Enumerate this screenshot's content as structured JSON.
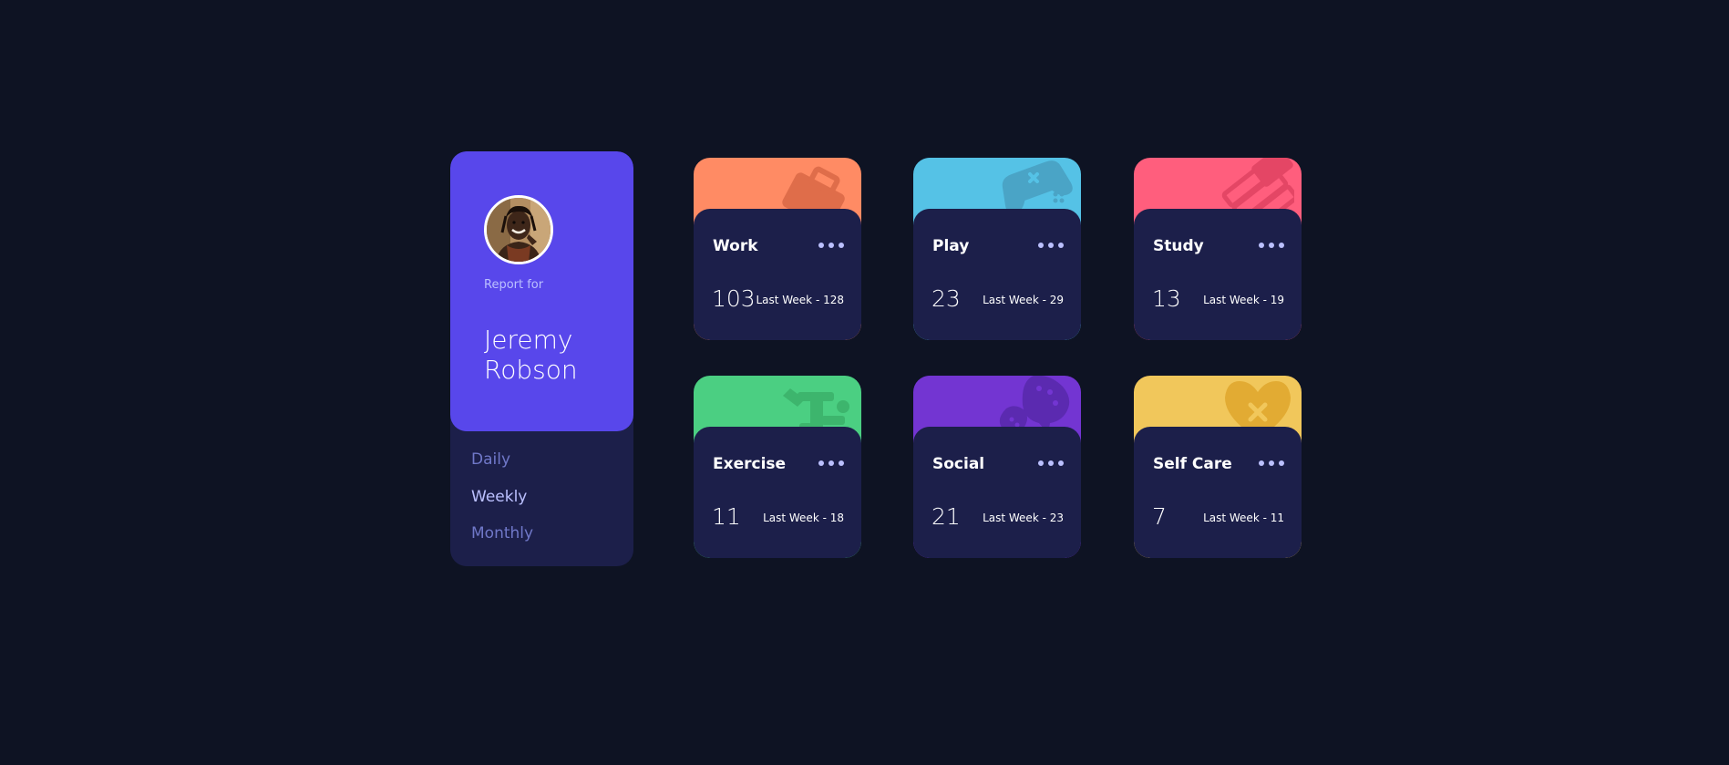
{
  "profile": {
    "report_label": "Report for",
    "name": "Jeremy Robson",
    "periods": [
      "Daily",
      "Weekly",
      "Monthly"
    ],
    "selected_period": "Weekly"
  },
  "cards": [
    {
      "title": "Work",
      "current": "103",
      "previous": "Last Week - 128",
      "color": "#ff8b64",
      "icon": "briefcase-icon"
    },
    {
      "title": "Play",
      "current": "23",
      "previous": "Last Week - 29",
      "color": "#55c2e6",
      "icon": "gamepad-icon"
    },
    {
      "title": "Study",
      "current": "13",
      "previous": "Last Week - 19",
      "color": "#ff5e7d",
      "icon": "books-icon"
    },
    {
      "title": "Exercise",
      "current": "11",
      "previous": "Last Week - 18",
      "color": "#4bcf82",
      "icon": "runner-icon"
    },
    {
      "title": "Social",
      "current": "21",
      "previous": "Last Week - 23",
      "color": "#7335d2",
      "icon": "chat-bubbles-icon"
    },
    {
      "title": "Self Care",
      "current": "7",
      "previous": "Last Week - 11",
      "color": "#f1c75b",
      "icon": "heart-bandage-icon"
    }
  ],
  "colors": {
    "background": "#0e1323",
    "panel": "#1c1f4a",
    "profile_accent": "#5847eb",
    "muted_text": "#7078c9",
    "pale_text": "#bbc0ff"
  }
}
